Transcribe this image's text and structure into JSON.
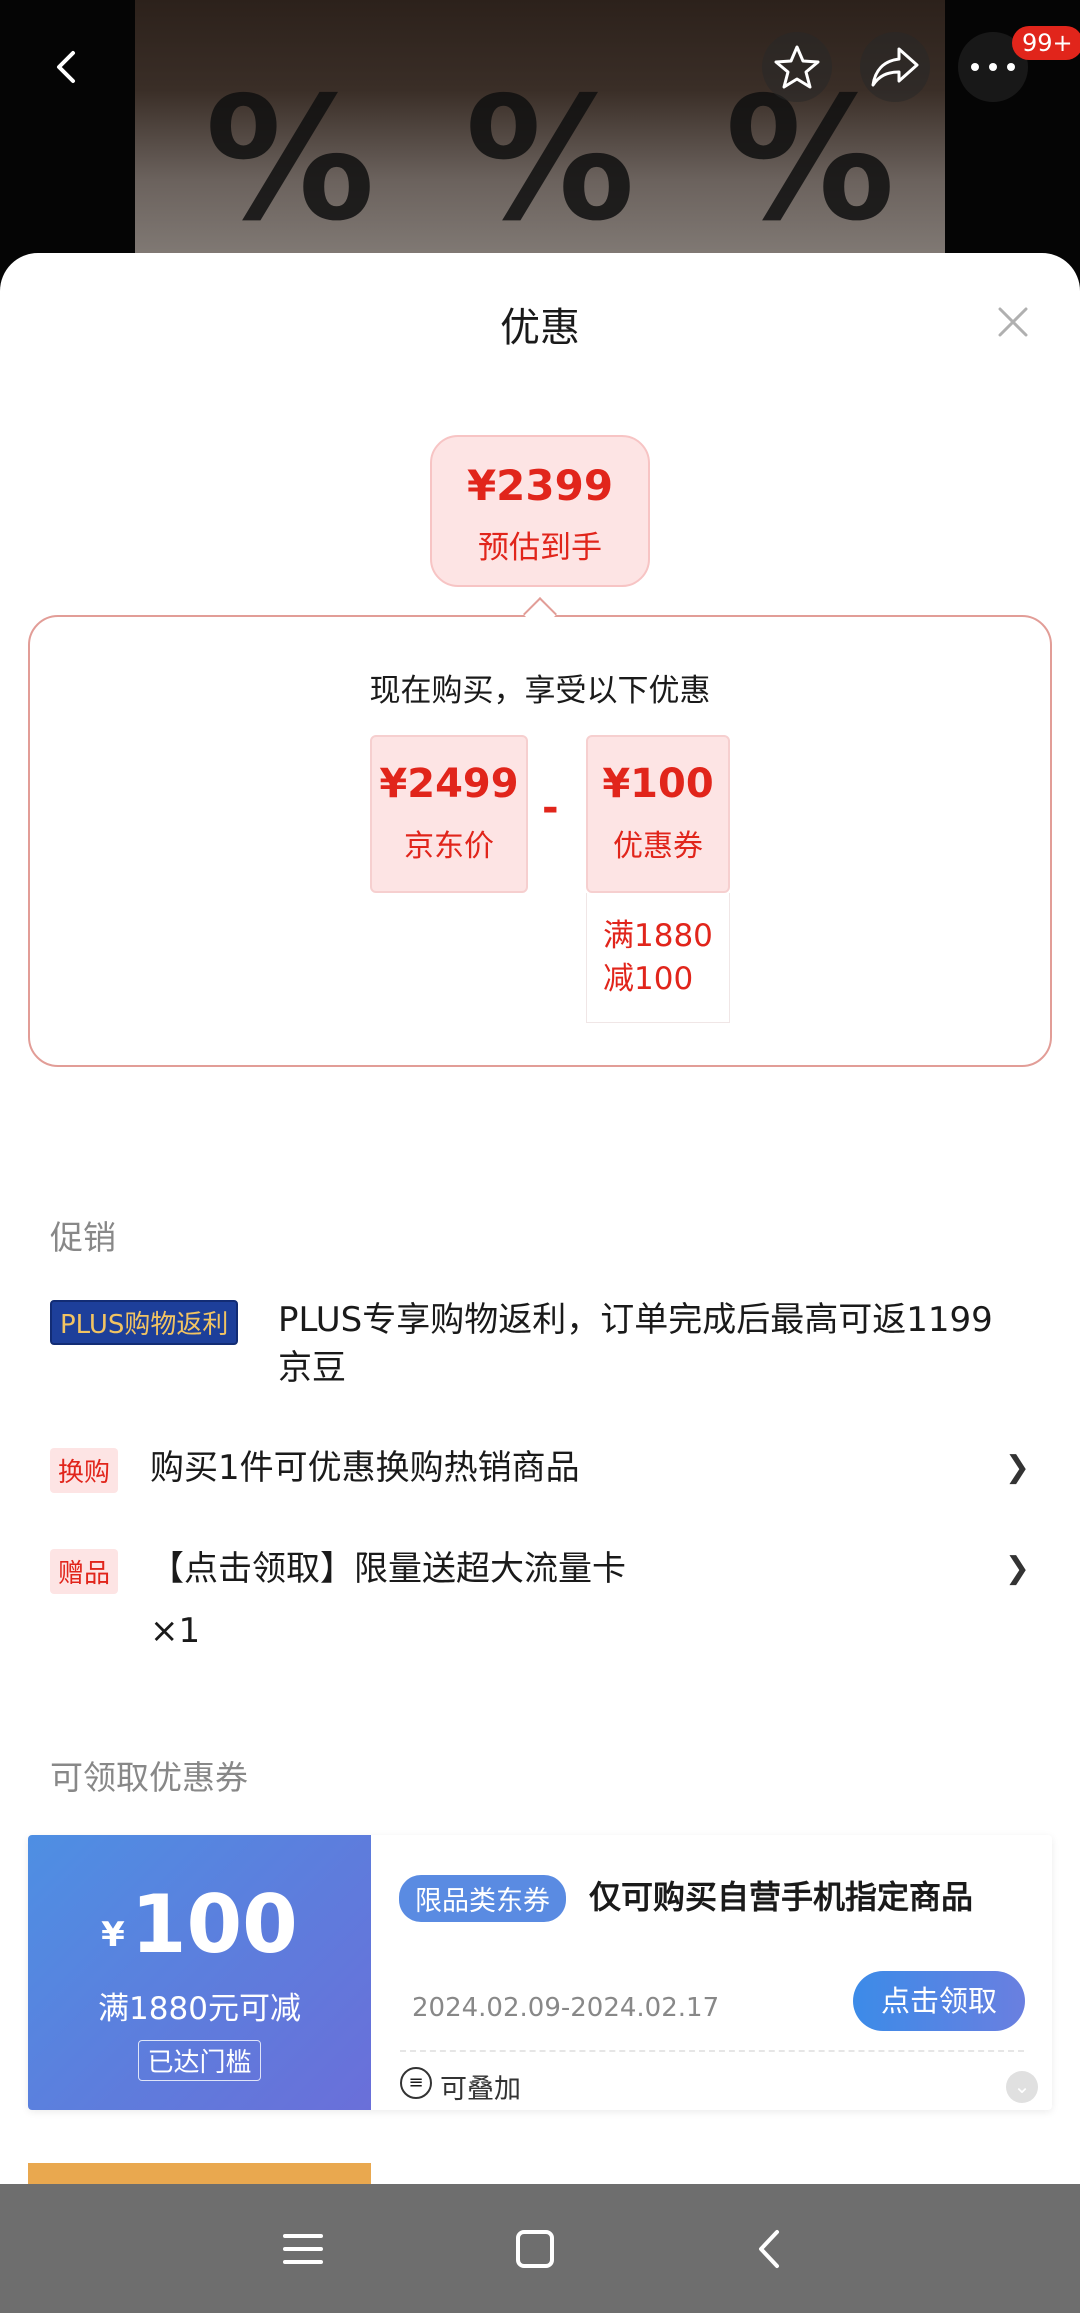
{
  "header": {
    "badge": "99+",
    "back_icon": "back-arrow-icon",
    "favorite_icon": "star-icon",
    "share_icon": "share-icon",
    "more_icon": "more-dots-icon"
  },
  "sheet": {
    "title": "优惠",
    "final_price": {
      "price": "¥2399",
      "label": "预估到手"
    },
    "calculation": {
      "heading": "现在购买，享受以下优惠",
      "base": {
        "value": "¥2499",
        "label": "京东价"
      },
      "operator": "-",
      "discount": {
        "value": "¥100",
        "label": "优惠券",
        "condition_line1": "满1880",
        "condition_line2": "减100"
      }
    }
  },
  "promotions": {
    "label": "促销",
    "items": [
      {
        "tag": "PLUS购物返利",
        "text_line1": "PLUS专享购物返利，订单完成后最高可返1199",
        "text_line2": "京豆"
      },
      {
        "tag": "换购",
        "text": "购买1件可优惠换购热销商品"
      },
      {
        "tag": "赠品",
        "text": "【点击领取】限量送超大流量卡",
        "qty": "×1"
      }
    ]
  },
  "coupons": {
    "label": "可领取优惠券",
    "items": [
      {
        "currency": "¥",
        "amount": "100",
        "condition": "满1880元可减",
        "status": "已达门槛",
        "type_tag": "限品类东券",
        "title": "仅可购买自营手机指定商品",
        "date_range": "2024.02.09-2024.02.17",
        "button": "点击领取",
        "stack_label": "可叠加"
      }
    ]
  },
  "colors": {
    "accent_red": "#e1251b",
    "coupon_blue": "#5a8be2"
  }
}
